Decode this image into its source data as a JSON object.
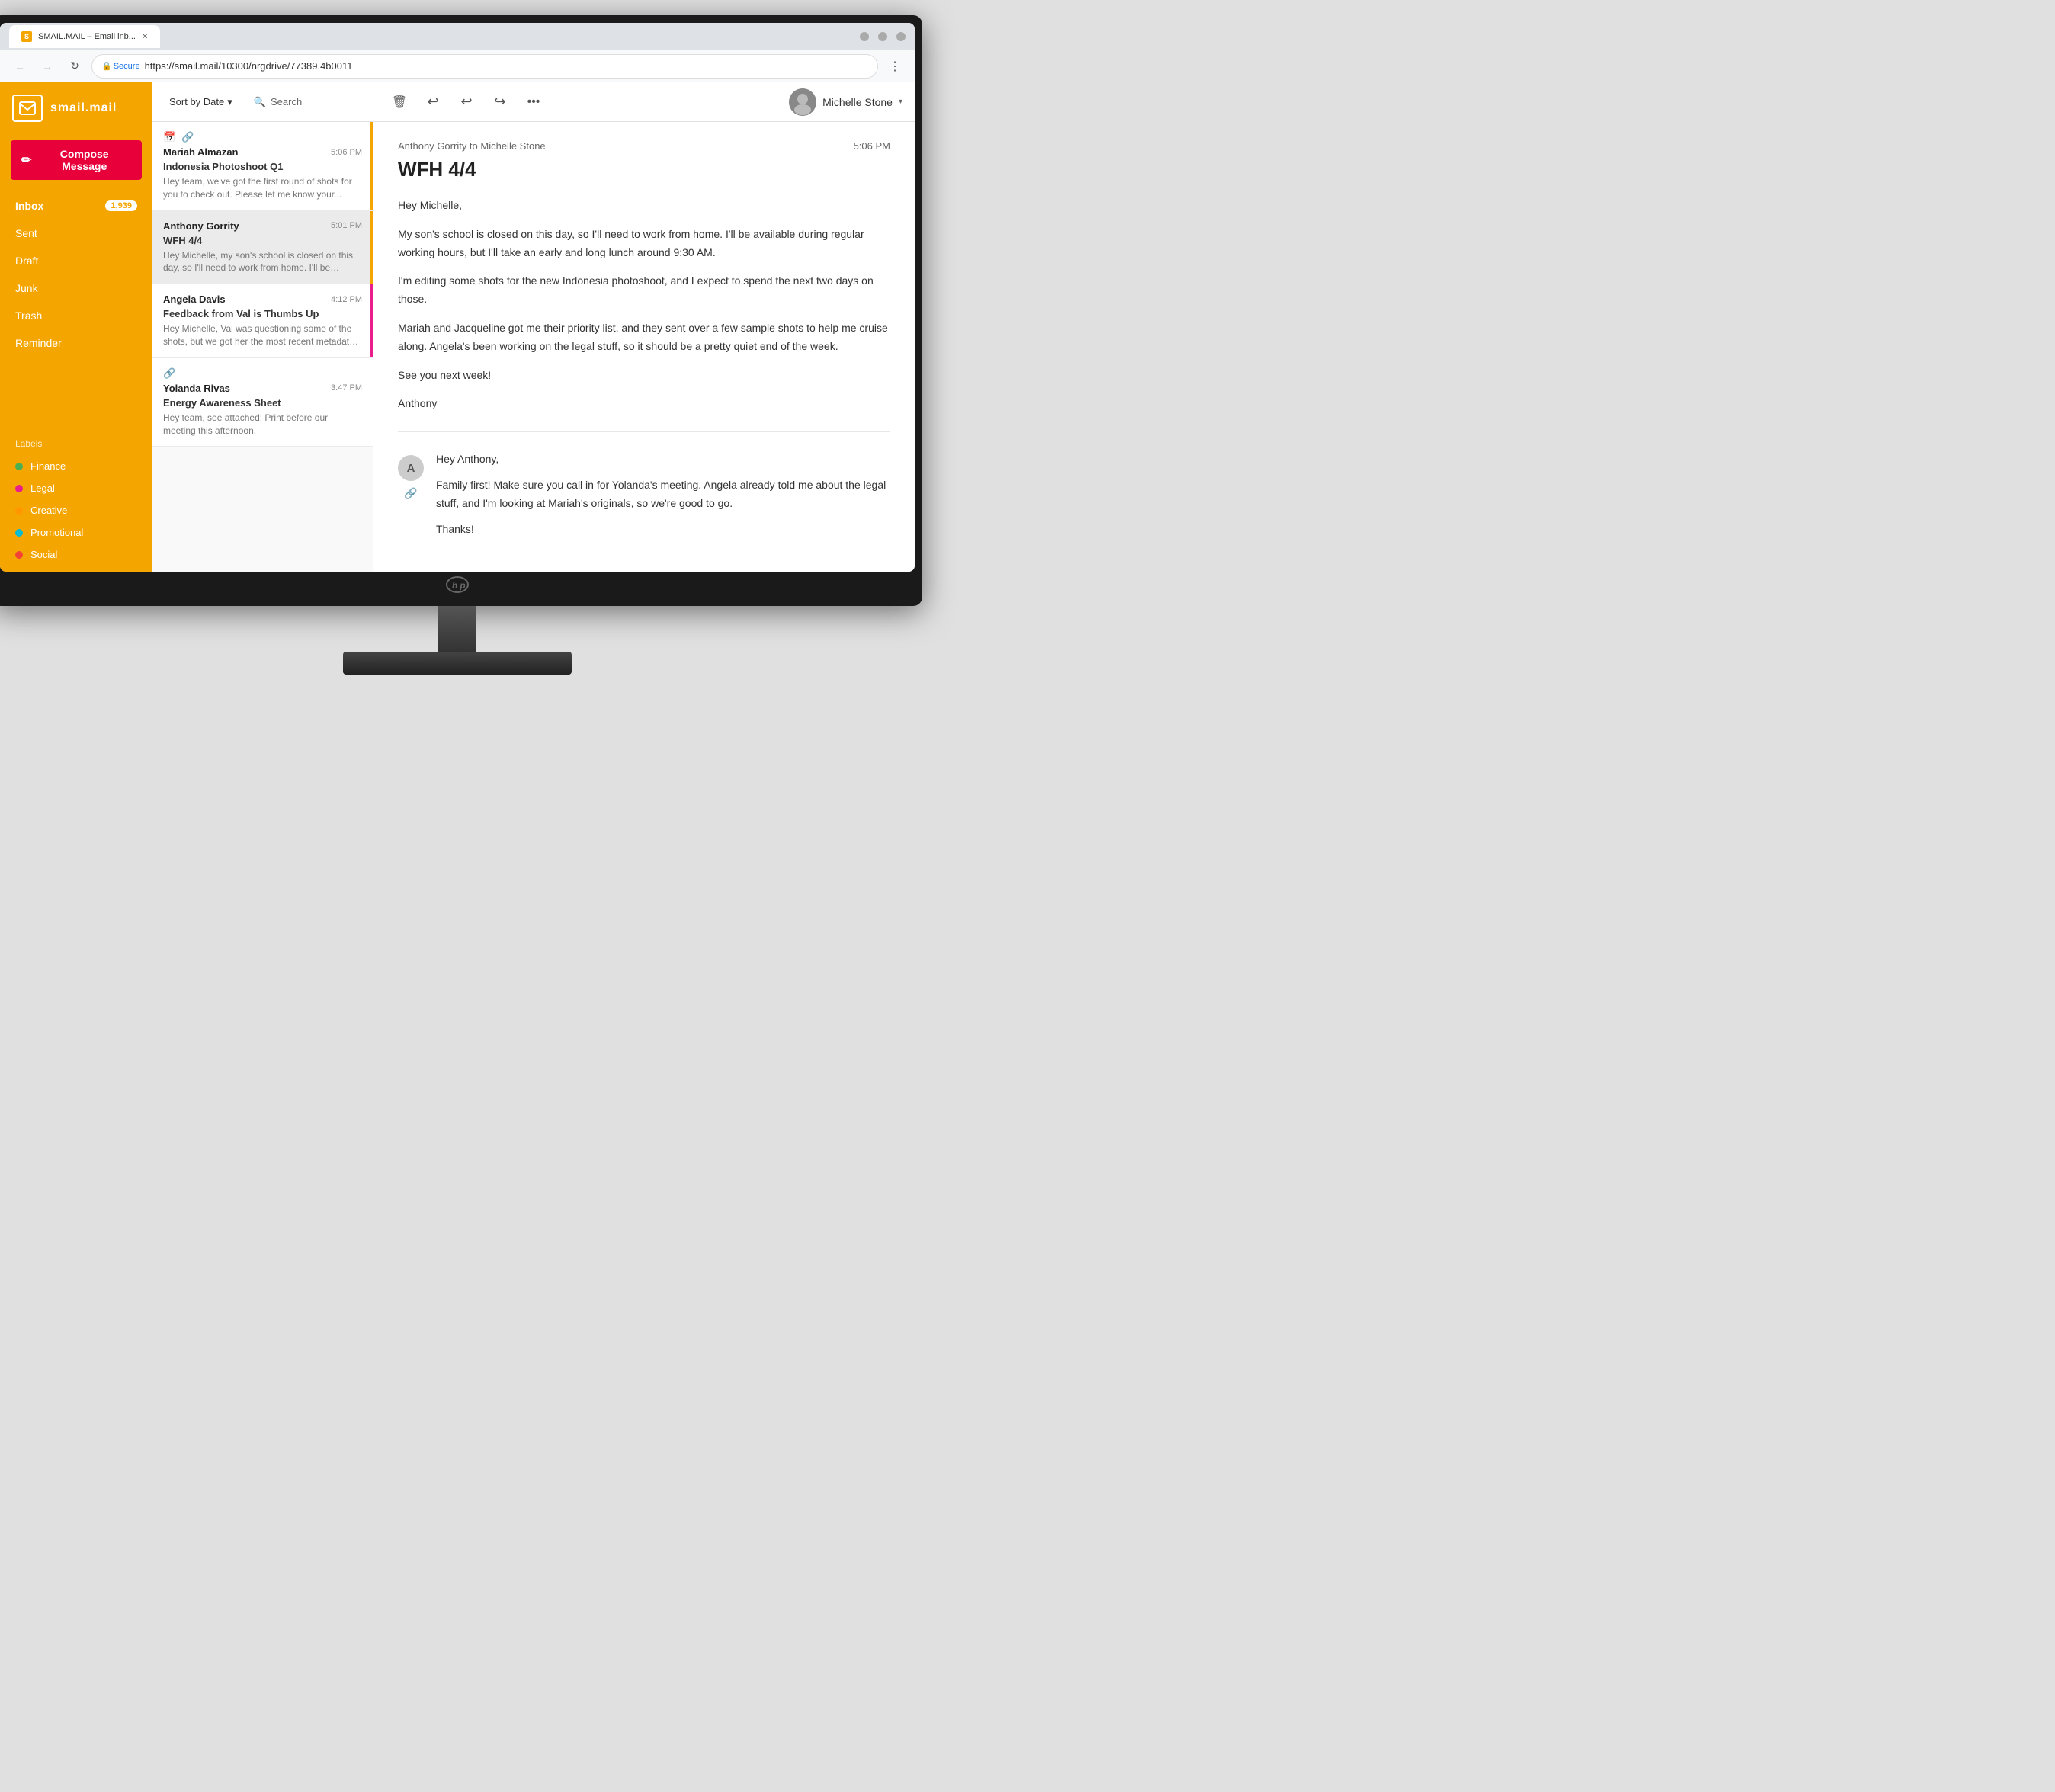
{
  "browser": {
    "tab_title": "SMAIL.MAIL – Email inb...",
    "url": "https://smail.mail/10300/nrgdrive/77389.4b0011",
    "secure_label": "Secure"
  },
  "sidebar": {
    "logo_text": "smail.mail",
    "compose_label": "Compose Message",
    "nav_items": [
      {
        "label": "Inbox",
        "badge": "1,939",
        "active": true
      },
      {
        "label": "Sent",
        "badge": null
      },
      {
        "label": "Draft",
        "badge": null
      },
      {
        "label": "Junk",
        "badge": null
      },
      {
        "label": "Trash",
        "badge": null
      },
      {
        "label": "Reminder",
        "badge": null
      }
    ],
    "labels_title": "Labels",
    "labels": [
      {
        "name": "Finance",
        "color": "#4caf50"
      },
      {
        "name": "Legal",
        "color": "#e91e8c"
      },
      {
        "name": "Creative",
        "color": "#ff9800"
      },
      {
        "name": "Promotional",
        "color": "#00bcd4"
      },
      {
        "name": "Social",
        "color": "#f44336"
      }
    ]
  },
  "list_toolbar": {
    "sort_label": "Sort by Date",
    "search_label": "Search",
    "chevron": "▾"
  },
  "emails": [
    {
      "sender": "Mariah Almazan",
      "subject": "Indonesia Photoshoot Q1",
      "preview": "Hey team, we've got the first round of shots for you to check out. Please let me know your...",
      "time": "5:06 PM",
      "accent_color": "#f4a500",
      "has_calendar": true,
      "has_attachment": true
    },
    {
      "sender": "Anthony Gorrity",
      "subject": "WFH 4/4",
      "preview": "Hey Michelle, my son's school is closed on this day, so I'll need to work from home. I'll be available...",
      "time": "5:01 PM",
      "accent_color": "#f4a500",
      "has_calendar": false,
      "has_attachment": false,
      "active": true
    },
    {
      "sender": "Angela Davis",
      "subject": "Feedback from Val is Thumbs Up",
      "preview": "Hey Michelle, Val was questioning some of the shots, but we got her the most recent metadata, and she said...",
      "time": "4:12 PM",
      "accent_color": "#e91e8c",
      "has_calendar": false,
      "has_attachment": false
    },
    {
      "sender": "Yolanda Rivas",
      "subject": "Energy Awareness Sheet",
      "preview": "Hey team, see attached! Print before our meeting this afternoon.",
      "time": "3:47 PM",
      "accent_color": null,
      "has_calendar": false,
      "has_attachment": true
    }
  ],
  "email_view": {
    "from_to": "Anthony Gorrity to Michelle Stone",
    "time": "5:06 PM",
    "subject": "WFH 4/4",
    "body_lines": [
      "Hey Michelle,",
      "My son's school is closed on this day, so I'll need to work from home. I'll be available during regular working hours, but I'll take an early and long lunch around 9:30 AM.",
      "I'm editing some shots for the new Indonesia photoshoot, and I expect to spend the next two days on those.",
      "Mariah and Jacqueline got me their priority list, and they sent over a few sample shots to help me cruise along. Angela's been working on the legal stuff, so it should be a pretty quiet end of the week.",
      "See you next week!",
      "Anthony"
    ],
    "reply_lines": [
      "Hey Anthony,",
      "Family first! Make sure you call in for Yolanda's meeting. Angela already told me about the legal stuff, and I'm looking at Mariah's originals, so we're good to go.",
      "Thanks!"
    ],
    "user_name": "Michelle Stone"
  },
  "toolbar_icons": {
    "delete": "🗑",
    "reply": "↩",
    "reply_all": "↩",
    "forward": "↪",
    "more": "•••"
  }
}
